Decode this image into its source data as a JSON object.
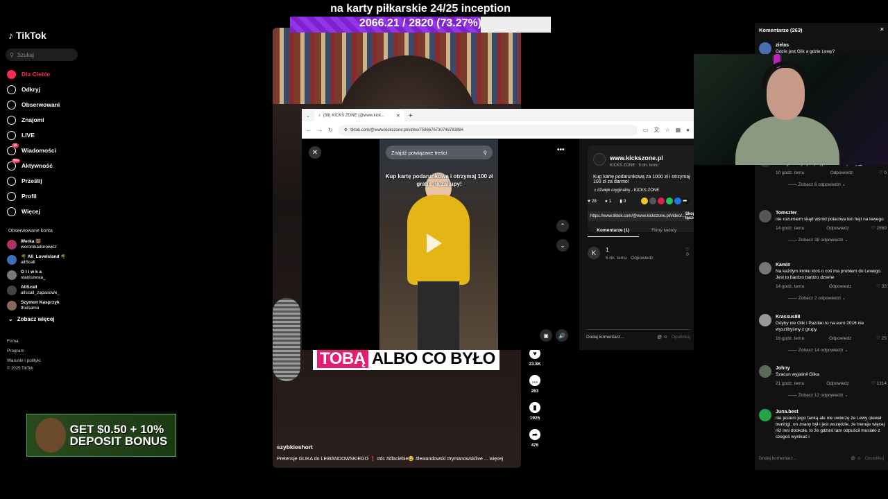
{
  "sidebar": {
    "logo": "TikTok",
    "search_placeholder": "Szukaj",
    "nav": [
      {
        "label": "Dla Ciebie",
        "icon": "home-icon"
      },
      {
        "label": "Odkryj",
        "icon": "compass-icon"
      },
      {
        "label": "Obserwowani",
        "icon": "following-icon"
      },
      {
        "label": "Znajomi",
        "icon": "friends-icon"
      },
      {
        "label": "LIVE",
        "icon": "live-icon"
      },
      {
        "label": "Wiadomości",
        "icon": "messages-icon",
        "badge": "15"
      },
      {
        "label": "Aktywność",
        "icon": "activity-icon",
        "badge": "99+"
      },
      {
        "label": "Prześlij",
        "icon": "upload-icon"
      },
      {
        "label": "Profil",
        "icon": "profile-icon"
      },
      {
        "label": "Więcej",
        "icon": "more-icon"
      }
    ],
    "followed_title": "Obserwowane konta",
    "accounts": [
      {
        "name": "Werka 🐻",
        "handle": "woronikadorowicz"
      },
      {
        "name": "🌴 All_LoveIsland 🌴",
        "handle": "allScall"
      },
      {
        "name": "O l i w k a",
        "handle": "staniszesia_"
      },
      {
        "name": "AllScall",
        "handle": "allscall_zapasowe_"
      },
      {
        "name": "Szymon Kasprzyk",
        "handle": "theisamu"
      }
    ],
    "see_more": "Zobacz więcej",
    "footer": [
      "Firma",
      "Program",
      "Warunki i polityki",
      "© 2025 TikTok"
    ]
  },
  "ad": {
    "line1": "GET $0.50 + 10%",
    "line2": "DEPOSIT BONUS"
  },
  "overlay": {
    "title": "na karty piłkarskie 24/25 inception",
    "progress_text": "2066.21 / 2820 (73.27%)",
    "progress": 0.7327
  },
  "video": {
    "caption_hl": "TOBĄ",
    "caption": "ALBO CO BYŁO",
    "author": "szybkieshort",
    "description": "Pretensje GLIKA do LEWANDOWSKIEGO ❗ #dc #dlaciebie😂 #lewandowski #rymanowskilive ... więcej",
    "likes": "23.8K",
    "comments": "263",
    "saves": "1925",
    "shares": "476"
  },
  "browser": {
    "tab_title": "(39) KICKS ZONE (@www.kick...",
    "url": "tiktok.com/@www.kickszone.pl/video/7586676730748783894",
    "find_related": "Znajdź powiązane treści",
    "video_text": "Kup kartę podarunkową i otrzymaj 100 zł gratis na zakupy!",
    "site": "www.kickszone.pl",
    "site_meta": "KICKS ZONE · 5 dn. temu",
    "post_title": "Kup kartę podarunkową za 1000 zł i otrzymaj 100 zł za darmo!",
    "sound": "dźwięk oryginalny - KICKS ZONE",
    "likes": "28",
    "comments": "1",
    "saves": "0",
    "link": "https://www.tiktok.com/@www.kickszone.pl/video/...",
    "copy": "Skopiuj łącze",
    "tab_comments": "Komentarze (1)",
    "tab_creator": "Filmy twórcy",
    "comment_initial": "K",
    "comment_text": "1",
    "comment_time": "5 dn. temu",
    "comment_reply": "Odpowiedz",
    "comment_likes": "0",
    "add_comment": "Dodaj komentarz...",
    "publish": "Opublikuj"
  },
  "comments_panel": {
    "title": "Komentarze (263)",
    "items": [
      {
        "user": "zielas",
        "text": "Gdzie jest Glik a gdzie Lewy?",
        "time": "",
        "likes": "",
        "replies": ""
      },
      {
        "user": "",
        "text": "na 3 razy w tygodniu po 8 godzin pracuje i też nie mam z czego ruszyc jak przyjeżdzam do pracy😭",
        "time": "10 godz. temu",
        "likes": "0",
        "replies": "Zobacz 6 odpowiedzi"
      },
      {
        "user": "Tomszter",
        "text": "nie rozumiem skąd wśród polactwa ten hejt na lewego",
        "time": "14 godz. temu",
        "likes": "2889",
        "replies": "Zobacz 38 odpowiedzi"
      },
      {
        "user": "Kamin",
        "text": "Na każdym kroku ktoś o coś ma problem do Lewego. Jest to bardzo bardzo dziwne",
        "time": "14 godz. temu",
        "likes": "33",
        "replies": "Zobacz 2 odpowiedzi"
      },
      {
        "user": "Krassus88",
        "text": "Gdyby nie Glik i Pazdan to na euro 2016 nie wyszlibyśmy z grupy.",
        "time": "16 godz. temu",
        "likes": "25",
        "replies": "Zobacz 14 odpowiedzi"
      },
      {
        "user": "Johny",
        "text": "Szacun wyjaśnił Glika",
        "time": "21 godz. temu",
        "likes": "1314",
        "replies": "Zobacz 12 odpowiedzi"
      },
      {
        "user": "Juna.best",
        "text": "nie jestem jego fanką ale nie uwierzę że Lewy olewał treningi. on znany był i jest wszędzie, że trenuje więcej niż inni dookoła. to że gdzieś tam odpuścił musiało z czegoś wynikać i",
        "time": "",
        "likes": "",
        "replies": ""
      }
    ],
    "reply": "Odpowiedz",
    "add_comment": "Dodaj komentarz...",
    "publish": "Opublikuj"
  },
  "colors": {
    "accent": "#fe2c55",
    "progress": "#9333ea"
  }
}
